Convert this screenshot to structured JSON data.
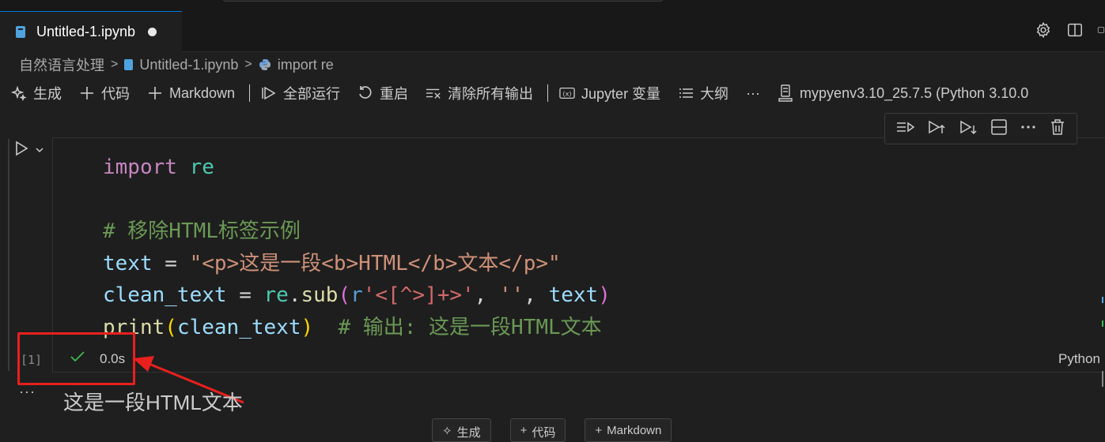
{
  "tab": {
    "title": "Untitled-1.ipynb"
  },
  "breadcrumb": {
    "folder": "自然语言处理",
    "file": "Untitled-1.ipynb",
    "symbol": "import re"
  },
  "toolbar": {
    "generate": "生成",
    "code": "代码",
    "markdown": "Markdown",
    "run_all": "全部运行",
    "restart": "重启",
    "clear_outputs": "清除所有输出",
    "variables": "Jupyter 变量",
    "outline": "大纲",
    "more": "···",
    "kernel": "mypyenv3.10_25.7.5 (Python 3.10.0"
  },
  "cell": {
    "execution_count": "[1]",
    "exec_time": "0.0s",
    "language": "Python",
    "output_more": "···",
    "output": "这是一段HTML文本",
    "code": {
      "l1_kw": "import",
      "l1_mod": "re",
      "l3_comment": "# 移除HTML标签示例",
      "l4_var": "text",
      "l4_op": " = ",
      "l4_str": "\"<p>这是一段<b>HTML</b>文本</p>\"",
      "l5_var": "clean_text",
      "l5_op": " = ",
      "l5_mod": "re",
      "l5_dot": ".",
      "l5_fn": "sub",
      "l5_p1": "(",
      "l5_r": "r",
      "l5_q1": "'",
      "l5_regex": "<[^>]+>",
      "l5_q2": "'",
      "l5_comma": ", ",
      "l5_empty": "''",
      "l5_comma2": ", ",
      "l5_arg": "text",
      "l5_p2": ")",
      "l6_fn": "print",
      "l6_p1": "(",
      "l6_arg": "clean_text",
      "l6_p2": ")",
      "l6_comment": "  # 输出: 这是一段HTML文本"
    }
  },
  "add_cell": {
    "generate": "生成",
    "code": "代码",
    "markdown": "Markdown"
  }
}
